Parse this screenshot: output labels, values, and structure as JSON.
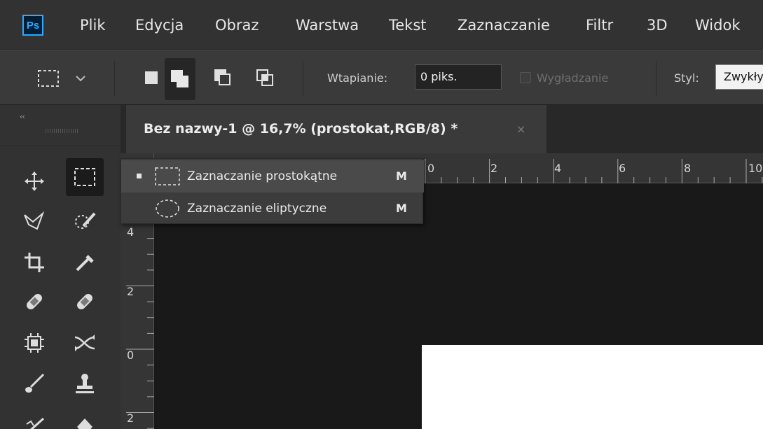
{
  "app": {
    "logo_text": "Ps",
    "accent_color": "#31a8ff"
  },
  "menu": {
    "items": [
      "Plik",
      "Edycja",
      "Obraz",
      "Warstwa",
      "Tekst",
      "Zaznaczanie",
      "Filtr",
      "3D",
      "Widok"
    ]
  },
  "options": {
    "feather_label": "Wtapianie:",
    "feather_value": "0 piks.",
    "antialias_label": "Wygładzanie",
    "antialias_checked": false,
    "style_label": "Styl:",
    "style_value": "Zwykły"
  },
  "toolbar": {
    "collapse_glyph": "‹‹",
    "active_tool": "rectangular-marquee-tool"
  },
  "document": {
    "tab_title": "Bez nazwy-1 @ 16,7% (prostokat,RGB/8) *",
    "close_glyph": "×"
  },
  "ruler": {
    "top_labels": [
      "0",
      "2",
      "4",
      "6",
      "8",
      "10"
    ],
    "left_labels": [
      "4",
      "2",
      "0",
      "2"
    ]
  },
  "flyout": {
    "items": [
      {
        "label": "Zaznaczanie prostokątne",
        "shortcut": "M",
        "selected": true
      },
      {
        "label": "Zaznaczanie eliptyczne",
        "shortcut": "M",
        "selected": false
      }
    ]
  }
}
